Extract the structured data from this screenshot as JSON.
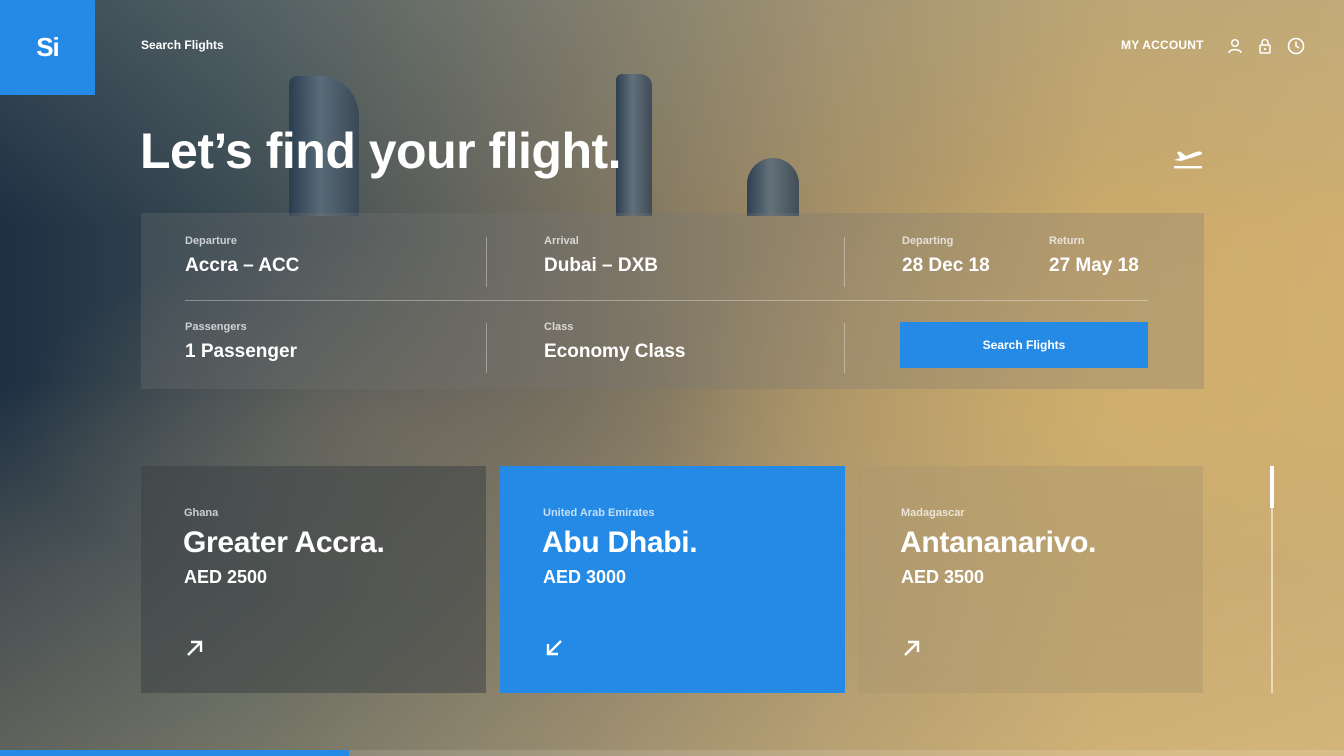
{
  "brand": {
    "logo_text": "Si",
    "accent": "#2589e6"
  },
  "header": {
    "nav_link": "Search Flights",
    "account_label": "MY ACCOUNT",
    "icons": [
      "user-icon",
      "lock-icon",
      "clock-icon"
    ]
  },
  "hero": {
    "headline": "Let’s find your flight.",
    "icon": "plane-takeoff-icon"
  },
  "search_form": {
    "departure": {
      "label": "Departure",
      "value": "Accra – ACC"
    },
    "arrival": {
      "label": "Arrival",
      "value": "Dubai – DXB"
    },
    "departing": {
      "label": "Departing",
      "value": "28 Dec 18"
    },
    "return": {
      "label": "Return",
      "value": "27 May 18"
    },
    "passengers": {
      "label": "Passengers",
      "value": "1 Passenger"
    },
    "class": {
      "label": "Class",
      "value": "Economy Class"
    },
    "search_button": "Search Flights"
  },
  "destinations": [
    {
      "country": "Ghana",
      "city": "Greater Accra.",
      "price": "AED 2500",
      "icon": "arrow-up-right-icon"
    },
    {
      "country": "United Arab Emirates",
      "city": "Abu Dhabi.",
      "price": "AED 3000",
      "icon": "arrow-down-left-icon",
      "selected": true
    },
    {
      "country": "Madagascar",
      "city": "Antananarivo.",
      "price": "AED 3500",
      "icon": "arrow-up-right-icon"
    }
  ],
  "page_progress": 0.26
}
